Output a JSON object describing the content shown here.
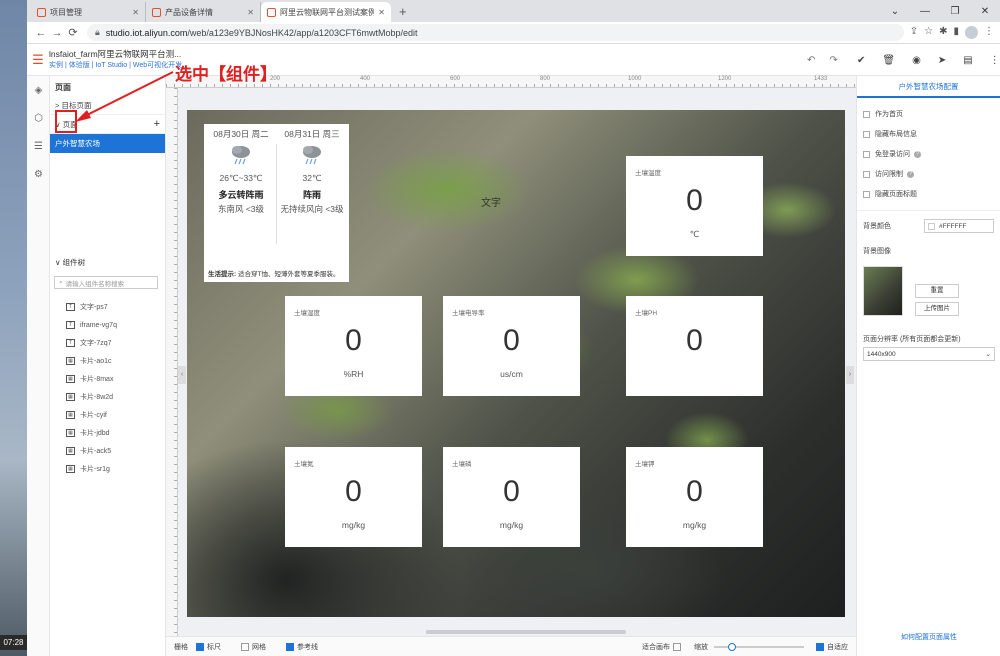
{
  "desktop": {
    "clock": "07:28"
  },
  "browser": {
    "tabs": [
      {
        "label": "项目管理",
        "active": false
      },
      {
        "label": "产品设备详情",
        "active": false
      },
      {
        "label": "阿里云物联网平台测试案例",
        "active": true
      }
    ],
    "new_tab": "+",
    "window_controls": [
      "⌄",
      "—",
      "❐",
      "✕"
    ],
    "url_host": "studio.iot.aliyun.com",
    "url_path": "/web/a123e9YBJNosHK42/app/a1203CFT6mwtMobp/edit"
  },
  "app": {
    "title": "lnsfaiot_farm阿里云物联网平台测...",
    "sub_links": "实例 | 体验版 | IoT Studio | Web可视化开发"
  },
  "left_panel": {
    "heading": "页面",
    "row_pages_folder": "> 目标页面",
    "row_pages": "∨ 页面",
    "add": "+",
    "selected_page": "户外智慧农场",
    "components_heading": "∨ 组件树",
    "search_placeholder": "请输入组件名称搜索",
    "components": [
      {
        "icon": "T",
        "label": "文字-ps7"
      },
      {
        "icon": "T",
        "label": "iframe-vg7q"
      },
      {
        "icon": "T",
        "label": "文字-7zq7"
      },
      {
        "icon": "▦",
        "label": "卡片-ao1c"
      },
      {
        "icon": "▦",
        "label": "卡片-8max"
      },
      {
        "icon": "▦",
        "label": "卡片-8w2d"
      },
      {
        "icon": "▦",
        "label": "卡片-cyif"
      },
      {
        "icon": "▦",
        "label": "卡片-jdbd"
      },
      {
        "icon": "▦",
        "label": "卡片-ack5"
      },
      {
        "icon": "▦",
        "label": "卡片-sr1g"
      }
    ]
  },
  "annotation": {
    "text": "选中【组件】"
  },
  "ruler": {
    "labels": [
      "200",
      "400",
      "600",
      "800",
      "1000",
      "1200",
      "1433"
    ]
  },
  "stage": {
    "floating_text": "文字",
    "weather": {
      "day1": {
        "date": "08月30日 周二",
        "temp": "26℃~33℃",
        "desc": "多云转阵雨",
        "wind": "东南风 <3级"
      },
      "day2": {
        "date": "08月31日 周三",
        "temp": "32℃",
        "desc": "阵雨",
        "wind": "无持续风向 <3级"
      },
      "tip_label": "生活提示:",
      "tip_text": "适合穿T恤、短薄外套等夏季服装。"
    },
    "cards": [
      {
        "label": "土壤温度",
        "value": "0",
        "unit": "℃"
      },
      {
        "label": "土壤湿度",
        "value": "0",
        "unit": "%RH"
      },
      {
        "label": "土壤电导率",
        "value": "0",
        "unit": "us/cm"
      },
      {
        "label": "土壤PH",
        "value": "0",
        "unit": ""
      },
      {
        "label": "土壤氮",
        "value": "0",
        "unit": "mg/kg"
      },
      {
        "label": "土壤磷",
        "value": "0",
        "unit": "mg/kg"
      },
      {
        "label": "土壤钾",
        "value": "0",
        "unit": "mg/kg"
      }
    ]
  },
  "bottom_bar": {
    "grid": "栅格",
    "ruler": "标尺",
    "mesh": "网格",
    "guides": "参考线",
    "fit_canvas": "适合画布",
    "zoom": "缩放",
    "auto_fit": "自适应"
  },
  "right_panel": {
    "tab": "户外智慧农场配置",
    "options": [
      {
        "label": "作为首页",
        "help": false
      },
      {
        "label": "隐藏布局信息",
        "help": false
      },
      {
        "label": "免登录访问",
        "help": true
      },
      {
        "label": "访问限制",
        "help": true
      },
      {
        "label": "隐藏页面标题",
        "help": false
      }
    ],
    "bg_color_label": "背景颜色",
    "bg_color_value": "#FFFFFF",
    "bg_image_label": "背景图像",
    "reset_button": "重置",
    "upload_button": "上传图片",
    "resolution_label": "页面分辨率 (所有页面都会更新)",
    "resolution_value": "1440x900",
    "bottom_link": "如何配置页面属性"
  }
}
